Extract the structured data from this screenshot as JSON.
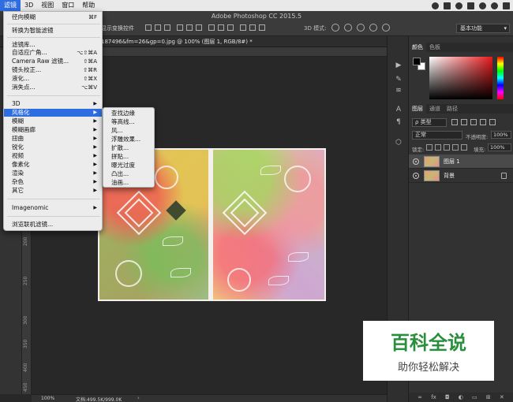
{
  "menubar": {
    "items": [
      "滤镜",
      "3D",
      "视图",
      "窗口",
      "帮助"
    ],
    "active": "滤镜"
  },
  "app_title": "Adobe Photoshop CC 2015.5",
  "options_bar": {
    "auto_select_label": "显示变换控件",
    "mode_3d_label": "3D 模式:",
    "workspace": "基本功能"
  },
  "document_tab": "187496&fm=26&gp=0.jpg @ 100% (图层 1, RGB/8#) *",
  "filter_menu": {
    "items": [
      {
        "label": "径向模糊",
        "shortcut": "⌘F"
      },
      {
        "label": "转换为智能滤镜"
      },
      {
        "label": "滤镜库..."
      },
      {
        "label": "自适应广角...",
        "shortcut": "⌥⇧⌘A"
      },
      {
        "label": "Camera Raw 滤镜...",
        "shortcut": "⇧⌘A"
      },
      {
        "label": "镜头校正...",
        "shortcut": "⇧⌘R"
      },
      {
        "label": "液化...",
        "shortcut": "⇧⌘X"
      },
      {
        "label": "消失点...",
        "shortcut": "⌥⌘V"
      },
      {
        "label": "3D"
      },
      {
        "label": "风格化"
      },
      {
        "label": "模糊"
      },
      {
        "label": "模糊画廊"
      },
      {
        "label": "扭曲"
      },
      {
        "label": "锐化"
      },
      {
        "label": "视频"
      },
      {
        "label": "像素化"
      },
      {
        "label": "渲染"
      },
      {
        "label": "杂色"
      },
      {
        "label": "其它"
      },
      {
        "label": "Imagenomic"
      },
      {
        "label": "浏览联机滤镜..."
      }
    ]
  },
  "stylize_submenu": {
    "items": [
      "查找边缘",
      "等高线...",
      "风...",
      "浮雕效果...",
      "扩散...",
      "拼贴...",
      "曝光过度",
      "凸出...",
      "油画..."
    ]
  },
  "ruler": {
    "top_marks": [],
    "left_marks": [
      "200",
      "250",
      "300",
      "350",
      "400",
      "450"
    ]
  },
  "status_bar": {
    "zoom": "100%",
    "doc_size": "文档:499.5K/999.0K"
  },
  "color_panel": {
    "tabs": [
      "颜色",
      "色板"
    ],
    "foreground": "#000000",
    "background": "#ffffff"
  },
  "layers_panel": {
    "tabs": [
      "图层",
      "通道",
      "路径"
    ],
    "filter_label": "ρ 类型",
    "blend_mode": "正常",
    "opacity_label": "不透明度:",
    "opacity_value": "100%",
    "lock_label": "锁定:",
    "fill_label": "填充:",
    "fill_value": "100%",
    "layers": [
      {
        "name": "图层 1",
        "selected": true
      },
      {
        "name": "背景",
        "locked": true
      }
    ]
  },
  "watermark": {
    "title": "百科全说",
    "subtitle": "助你轻松解决"
  }
}
